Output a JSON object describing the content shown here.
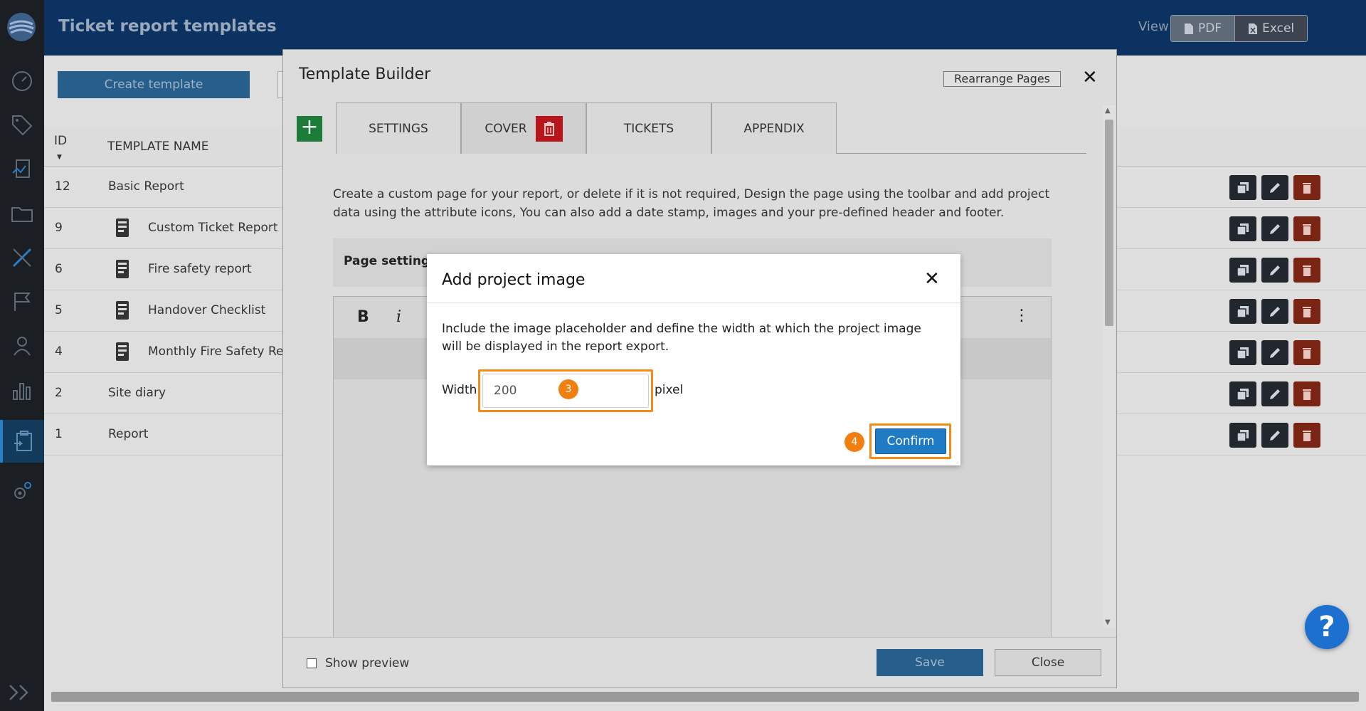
{
  "header": {
    "title": "Ticket report templates",
    "view_label": "View",
    "view_pdf": "PDF",
    "view_excel": "Excel"
  },
  "toolbar": {
    "create_template": "Create template"
  },
  "table": {
    "col_id": "ID",
    "col_name": "TEMPLATE NAME",
    "rows": [
      {
        "id": "12",
        "name": "Basic Report"
      },
      {
        "id": "9",
        "name": "Custom Ticket Report"
      },
      {
        "id": "6",
        "name": "Fire safety report"
      },
      {
        "id": "5",
        "name": "Handover Checklist"
      },
      {
        "id": "4",
        "name": "Monthly Fire Safety Repo"
      },
      {
        "id": "2",
        "name": "Site diary"
      },
      {
        "id": "1",
        "name": "Report"
      }
    ]
  },
  "builder": {
    "title": "Template Builder",
    "rearrange": "Rearrange Pages",
    "add_label": "+",
    "tabs": {
      "settings": "SETTINGS",
      "cover": "COVER",
      "tickets": "TICKETS",
      "appendix": "APPENDIX"
    },
    "description": "Create a custom page for your report, or delete if it is not required, Design the page using the toolbar and add project data using the attribute icons, You can also add a date stamp, images and your pre-defined header and footer.",
    "page_settings": "Page settings",
    "editor": {
      "bold": "B",
      "italic": "i",
      "more": "⋮"
    },
    "show_preview": "Show preview",
    "save": "Save",
    "close": "Close"
  },
  "dialog": {
    "title": "Add project image",
    "description": "Include the image placeholder and define the width at which the project image will be displayed in the report export.",
    "width_label": "Width",
    "width_value": "200",
    "unit": "pixel",
    "step_3": "3",
    "step_4": "4",
    "confirm": "Confirm"
  },
  "help": {
    "label": "?"
  },
  "colors": {
    "header_bg": "#0b3260",
    "sidebar_bg": "#1b1e23",
    "accent_orange": "#f28c1b",
    "confirm_blue": "#1e7bc4",
    "delete_red": "#b8161b",
    "add_green": "#1d7c3a",
    "help_blue": "#1d6fd0"
  },
  "icons": {
    "sidebar": [
      "dashboard-icon",
      "tag-icon",
      "report-icon",
      "folder-icon",
      "tools-icon",
      "flag-icon",
      "user-icon",
      "chart-icon",
      "clipboard-icon",
      "settings-icon"
    ],
    "row_actions": [
      "duplicate-icon",
      "edit-icon",
      "delete-icon"
    ]
  }
}
